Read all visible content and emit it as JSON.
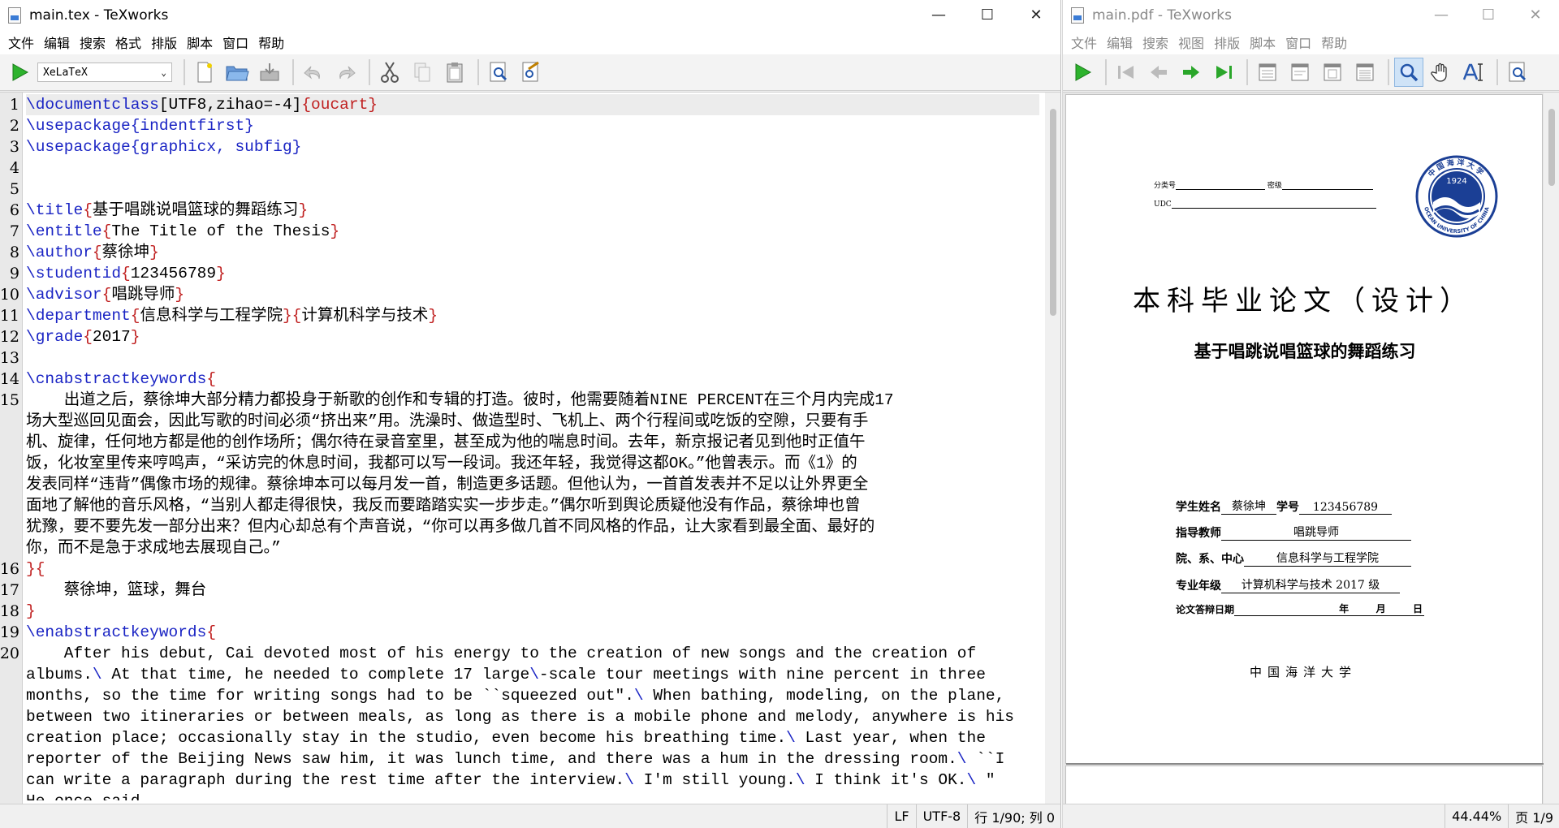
{
  "editor": {
    "title": "main.tex - TeXworks",
    "menu": [
      "文件",
      "编辑",
      "搜索",
      "格式",
      "排版",
      "脚本",
      "窗口",
      "帮助"
    ],
    "engine": "XeLaTeX",
    "status": {
      "eol": "LF",
      "encoding": "UTF-8",
      "position": "行 1/90; 列 0"
    },
    "line_numbers": [
      "1",
      "2",
      "3",
      "4",
      "5",
      "6",
      "7",
      "8",
      "9",
      "10",
      "11",
      "12",
      "13",
      "14",
      "15",
      "16",
      "17",
      "18",
      "19",
      "20"
    ],
    "lines": {
      "l1_cmd": "\\documentclass",
      "l1_rest": "[UTF8,zihao=-4]",
      "l1_arg": "{oucart}",
      "l2_cmd": "\\usepackage",
      "l2_arg": "{indentfirst}",
      "l3_cmd": "\\usepackage",
      "l3_arg": "{graphicx, subfig}",
      "l6_cmd": "\\title",
      "l6_arg": "基于唱跳说唱篮球的舞蹈练习",
      "l7_cmd": "\\entitle",
      "l7_arg": "The Title of the Thesis",
      "l8_cmd": "\\author",
      "l8_arg": "蔡徐坤",
      "l9_cmd": "\\studentid",
      "l9_arg": "123456789",
      "l10_cmd": "\\advisor",
      "l10_arg": "唱跳导师",
      "l11_cmd": "\\department",
      "l11_arg1": "信息科学与工程学院",
      "l11_arg2": "计算机科学与技术",
      "l12_cmd": "\\grade",
      "l12_arg": "2017",
      "l14_cmd": "\\cnabstractkeywords",
      "l15_wrapped": [
        "    出道之后，蔡徐坤大部分精力都投身于新歌的创作和专辑的打造。彼时，他需要随着NINE PERCENT在三个月内完成17",
        "场大型巡回见面会，因此写歌的时间必须“挤出来”用。洗澡时、做造型时、飞机上、两个行程间或吃饭的空隙，只要有手",
        "机、旋律，任何地方都是他的创作场所；偶尔待在录音室里，甚至成为他的喘息时间。去年，新京报记者见到他时正值午",
        "饭，化妆室里传来哼鸣声，“采访完的休息时间，我都可以写一段词。我还年轻，我觉得这都OK。”他曾表示。而《1》的",
        "发表同样“违背”偶像市场的规律。蔡徐坤本可以每月发一首，制造更多话题。但他认为，一首首发表并不足以让外界更全",
        "面地了解他的音乐风格，“当别人都走得很快，我反而要踏踏实实一步步走。”偶尔听到舆论质疑他没有作品，蔡徐坤也曾",
        "犹豫，要不要先发一部分出来？但内心却总有个声音说，“你可以再多做几首不同风格的作品，让大家看到最全面、最好的",
        "你，而不是急于求成地去展现自己。”"
      ],
      "l17_text": "    蔡徐坤，篮球，舞台",
      "l19_cmd": "\\enabstractkeywords",
      "l20_wrapped": [
        "    After his debut, Cai devoted most of his energy to the creation of new songs and the creation of",
        "albums.",
        " At that time, he needed to complete 17 large",
        "-scale tour meetings with nine percent in three",
        "months, so the time for writing songs had to be ``squeezed out\".",
        " When bathing, modeling, on the plane,",
        "between two itineraries or between meals, as long as there is a mobile phone and melody, anywhere is his",
        "creation place; occasionally stay in the studio, even become his breathing time.",
        " Last year, when the",
        "reporter of the Beijing News saw him, it was lunch time, and there was a hum in the dressing room.",
        " ``I",
        "can write a paragraph during the rest time after the interview.",
        " I'm still young.",
        " I think it's OK.",
        " \"",
        "He once said."
      ]
    }
  },
  "pdf": {
    "title": "main.pdf - TeXworks",
    "menu": [
      "文件",
      "编辑",
      "搜索",
      "视图",
      "排版",
      "脚本",
      "窗口",
      "帮助"
    ],
    "status": {
      "zoom": "44.44%",
      "page": "页 1/9"
    },
    "page": {
      "classno_label": "分类号",
      "secret_label": "密级",
      "udc_label": "UDC",
      "seal_year": "1924",
      "seal_top": "中国海洋大学",
      "seal_bottom": "OCEAN UNIVERSITY OF CHINA",
      "big_title": "本科毕业论文（设计）",
      "thesis_title": "基于唱跳说唱篮球的舞蹈练习",
      "rows": [
        {
          "label": "学生姓名",
          "value": "蔡徐坤",
          "label2": "学号",
          "value2": "123456789"
        },
        {
          "label": "指导教师",
          "value": "唱跳导师"
        },
        {
          "label": "院、系、中心",
          "value": "信息科学与工程学院"
        },
        {
          "label": "专业年级",
          "value": "计算机科学与技术 2017 级"
        },
        {
          "label": "论文答辩日期",
          "value": "",
          "y": "年",
          "m": "月",
          "d": "日"
        }
      ],
      "university": "中国海洋大学"
    }
  }
}
